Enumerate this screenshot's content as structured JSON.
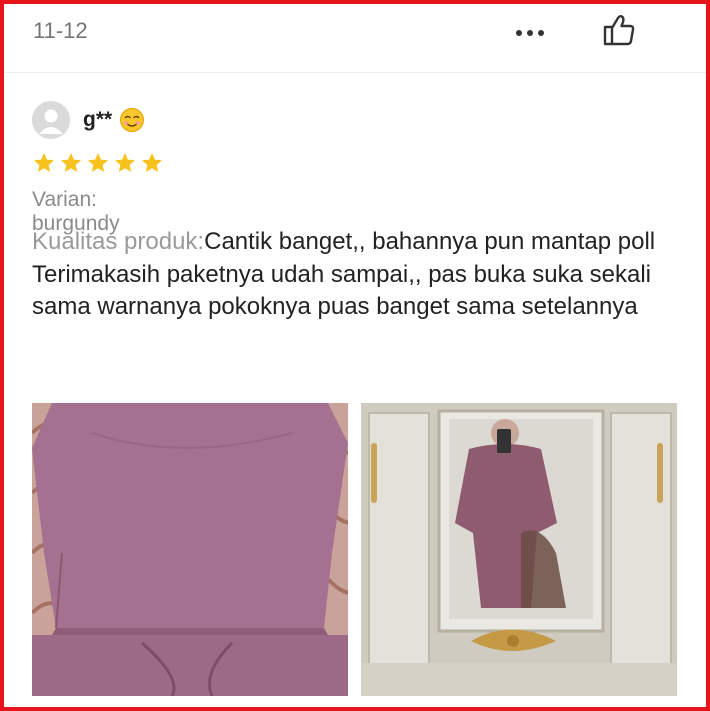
{
  "header": {
    "date": "11-12",
    "more_icon": "more-dots-icon",
    "like_icon": "thumbs-up-icon"
  },
  "review": {
    "username": "g**",
    "emoji": "smiling-face-emoji",
    "rating": 5,
    "rating_max": 5,
    "star_color": "#f7c21d",
    "variant": "Varian: burgundy",
    "quality_label": "Kualitas produk:",
    "quality_text": "Cantik banget,, bahannya pun mantap poll",
    "body_text": "Terimakasih paketnya udah sampai,, pas buka suka sekali sama warnanya pokoknya puas banget sama setelannya",
    "photos": [
      {
        "name": "review-photo-clothing"
      },
      {
        "name": "review-photo-mirror-selfie"
      }
    ]
  },
  "colors": {
    "frame": "#e8141b",
    "text": "#222222",
    "muted": "#8a8a8a",
    "garment": "#a06d8a"
  }
}
